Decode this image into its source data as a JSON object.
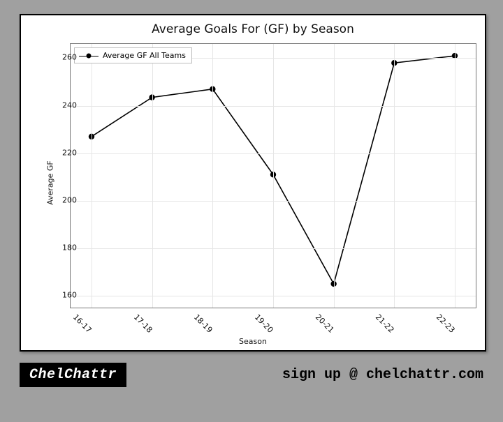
{
  "chart_data": {
    "type": "line",
    "title": "Average Goals For (GF) by Season",
    "xlabel": "Season",
    "ylabel": "Average GF",
    "categories": [
      "16-17",
      "17-18",
      "18-19",
      "19-20",
      "20-21",
      "21-22",
      "22-23"
    ],
    "series": [
      {
        "name": "Average GF All Teams",
        "values": [
          227,
          243.5,
          247,
          211,
          165,
          258,
          261
        ]
      }
    ],
    "ylim": [
      155,
      266
    ],
    "yticks": [
      160,
      180,
      200,
      220,
      240,
      260
    ],
    "legend_position": "upper left",
    "grid": true
  },
  "footer": {
    "brand": "ChelChattr",
    "signup": "sign up @ chelchattr.com"
  }
}
